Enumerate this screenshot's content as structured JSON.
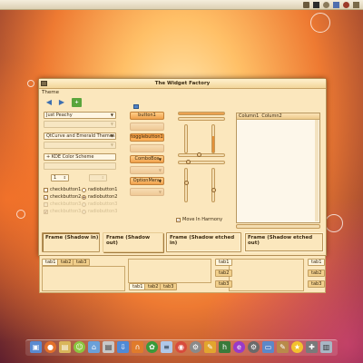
{
  "window": {
    "title": "The Widget Factory"
  },
  "menu": {
    "theme": "Theme"
  },
  "combos": {
    "theme_scheme": "Just Peachy",
    "qtcurve": "QtCurve and Emerald Themes",
    "kde_scheme": "+ KDE Color Scheme",
    "spin_value": "1"
  },
  "buttons": {
    "button1": "button1",
    "togglebutton1": "togglebutton1",
    "combobox": "ComboBox",
    "optionmenu": "OptionMenu"
  },
  "checks": {
    "checkbutton1": "checkbutton1",
    "checkbutton2": "checkbutton2",
    "radiobutton1": "radiobutton1",
    "radiobutton2": "radiobutton2",
    "checkbutton3": "checkbutton3",
    "radiobutton3": "radiobutton3"
  },
  "move_in_harmony": "Move In Harmony",
  "tree": {
    "col1": "Column1",
    "col2": "Column2"
  },
  "frames": {
    "shadow_in": "Frame (Shadow in)",
    "shadow_out": "Frame (Shadow out)",
    "shadow_etched_in": "Frame (Shadow etched in)",
    "shadow_etched_out": "Frame (Shadow etched out)"
  },
  "tabs": {
    "tab1": "tab1",
    "tab2": "tab2",
    "tab3": "tab3"
  },
  "colors": {
    "window_bg": "#fbe7bd",
    "accent": "#f0a04a",
    "border": "#b89861"
  },
  "dock_icons": [
    "finder-icon",
    "firefox-icon",
    "folder-icon",
    "android-icon",
    "home-icon",
    "download-icon",
    "magnet-icon",
    "game-icon",
    "terminal-icon",
    "firefox2-icon",
    "settings-icon",
    "help-icon",
    "hedgewars-icon",
    "chrome-icon",
    "settings-icon",
    "display-icon",
    "edit-icon",
    "star-icon",
    "gamepad-icon",
    "trash-icon"
  ]
}
